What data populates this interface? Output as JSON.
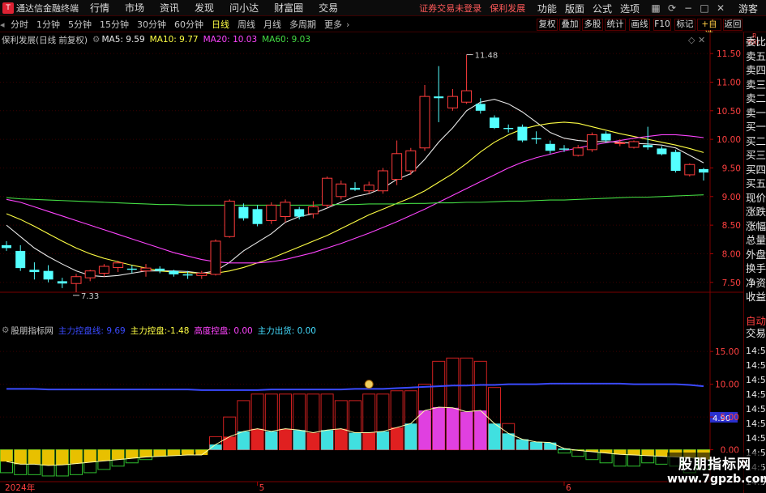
{
  "menubar": {
    "title": "通达信金融终端",
    "items": [
      "行情",
      "市场",
      "资讯",
      "发现",
      "问小达",
      "财富圈",
      "交易"
    ],
    "warnings": [
      "证券交易未登录",
      "保利发展"
    ],
    "right_items": [
      "功能",
      "版面",
      "公式",
      "选项"
    ],
    "guest": "游客"
  },
  "periodbar": {
    "periods": [
      "分时",
      "1分钟",
      "5分钟",
      "15分钟",
      "30分钟",
      "60分钟",
      "日线",
      "周线",
      "月线",
      "多周期",
      "更多"
    ],
    "active": "日线",
    "buttons": [
      "复权",
      "叠加",
      "多股",
      "统计",
      "画线",
      "F10",
      "标记",
      "+自选",
      "返回"
    ]
  },
  "price_panel": {
    "stock_label": "保利发展(日线 前复权)",
    "ma": [
      {
        "name": "MA5",
        "value": "9.59",
        "color": "#e8e8e8"
      },
      {
        "name": "MA10",
        "value": "9.77",
        "color": "#ffff44"
      },
      {
        "name": "MA20",
        "value": "10.03",
        "color": "#ff44ff"
      },
      {
        "name": "MA60",
        "value": "9.03",
        "color": "#44dd44"
      }
    ],
    "high_marker": "11.48",
    "low_marker": "7.33",
    "y_ticks": [
      "11.50",
      "11.00",
      "10.50",
      "10.00",
      "9.50",
      "9.00",
      "8.50",
      "8.00",
      "7.50"
    ]
  },
  "indicator_panel": {
    "label": "股朋指标网",
    "items": [
      {
        "name": "主力控盘线:",
        "value": "9.69",
        "color": "#3a4aff"
      },
      {
        "name": "主力控盘:",
        "value": "-1.48",
        "color": "#ffff44"
      },
      {
        "name": "高度控盘:",
        "value": "0.00",
        "color": "#ff44ff"
      },
      {
        "name": "主力出货:",
        "value": "0.00",
        "color": "#44ddff"
      }
    ],
    "y_ticks": [
      "15.00",
      "10.00",
      "5.00",
      "0.00"
    ],
    "current_tag": "4.90"
  },
  "right_panel": {
    "top_labels": [
      "R",
      "300"
    ],
    "labels": [
      "委比",
      "卖五",
      "卖四",
      "卖三",
      "卖二",
      "卖一",
      "买一",
      "买二",
      "买三",
      "买四",
      "买五",
      "现价",
      "涨跌",
      "涨幅",
      "总量",
      "外盘",
      "换手",
      "净资",
      "收益"
    ],
    "auto": "自动",
    "trade": "交易",
    "times": [
      "14:56",
      "14:56",
      "14:56",
      "14:56",
      "14:56",
      "14:56",
      "14:56",
      "14:56",
      "14:56",
      "14:56"
    ]
  },
  "x_axis": [
    "2024年",
    "5",
    "6"
  ],
  "watermark": {
    "line1": "股朋指标网",
    "line2": "www.7gpzb.com"
  },
  "chart_data": [
    {
      "type": "candlestick",
      "title": "保利发展(日线 前复权)",
      "ylim": [
        7.2,
        11.7
      ],
      "candles": [
        {
          "o": 8.15,
          "h": 8.22,
          "l": 8.05,
          "c": 8.1
        },
        {
          "o": 8.05,
          "h": 8.15,
          "l": 7.7,
          "c": 7.75
        },
        {
          "o": 7.72,
          "h": 7.85,
          "l": 7.55,
          "c": 7.68
        },
        {
          "o": 7.7,
          "h": 7.8,
          "l": 7.5,
          "c": 7.55
        },
        {
          "o": 7.52,
          "h": 7.58,
          "l": 7.4,
          "c": 7.48
        },
        {
          "o": 7.48,
          "h": 7.65,
          "l": 7.33,
          "c": 7.6
        },
        {
          "o": 7.58,
          "h": 7.72,
          "l": 7.52,
          "c": 7.7
        },
        {
          "o": 7.66,
          "h": 7.82,
          "l": 7.6,
          "c": 7.78
        },
        {
          "o": 7.76,
          "h": 7.88,
          "l": 7.68,
          "c": 7.84
        },
        {
          "o": 7.74,
          "h": 7.8,
          "l": 7.66,
          "c": 7.72
        },
        {
          "o": 7.7,
          "h": 7.82,
          "l": 7.6,
          "c": 7.75
        },
        {
          "o": 7.74,
          "h": 7.78,
          "l": 7.66,
          "c": 7.7
        },
        {
          "o": 7.7,
          "h": 7.72,
          "l": 7.6,
          "c": 7.64
        },
        {
          "o": 7.64,
          "h": 7.7,
          "l": 7.56,
          "c": 7.62
        },
        {
          "o": 7.62,
          "h": 7.7,
          "l": 7.56,
          "c": 7.66
        },
        {
          "o": 7.64,
          "h": 8.25,
          "l": 7.62,
          "c": 8.22
        },
        {
          "o": 8.3,
          "h": 8.95,
          "l": 8.28,
          "c": 8.92
        },
        {
          "o": 8.82,
          "h": 8.88,
          "l": 8.58,
          "c": 8.62
        },
        {
          "o": 8.78,
          "h": 8.85,
          "l": 8.48,
          "c": 8.52
        },
        {
          "o": 8.58,
          "h": 8.9,
          "l": 8.52,
          "c": 8.85
        },
        {
          "o": 8.65,
          "h": 8.95,
          "l": 8.55,
          "c": 8.9
        },
        {
          "o": 8.78,
          "h": 8.82,
          "l": 8.6,
          "c": 8.65
        },
        {
          "o": 8.7,
          "h": 8.92,
          "l": 8.62,
          "c": 8.82
        },
        {
          "o": 8.85,
          "h": 9.35,
          "l": 8.8,
          "c": 9.32
        },
        {
          "o": 9.0,
          "h": 9.28,
          "l": 8.95,
          "c": 9.22
        },
        {
          "o": 9.15,
          "h": 9.25,
          "l": 9.1,
          "c": 9.12
        },
        {
          "o": 9.1,
          "h": 9.26,
          "l": 9.05,
          "c": 9.2
        },
        {
          "o": 9.1,
          "h": 9.5,
          "l": 9.05,
          "c": 9.45
        },
        {
          "o": 9.3,
          "h": 9.98,
          "l": 9.2,
          "c": 9.75
        },
        {
          "o": 9.45,
          "h": 9.85,
          "l": 9.38,
          "c": 9.8
        },
        {
          "o": 9.85,
          "h": 10.95,
          "l": 9.8,
          "c": 10.75
        },
        {
          "o": 10.75,
          "h": 11.28,
          "l": 10.3,
          "c": 10.72
        },
        {
          "o": 10.55,
          "h": 10.88,
          "l": 10.5,
          "c": 10.75
        },
        {
          "o": 10.65,
          "h": 11.48,
          "l": 10.62,
          "c": 10.85
        },
        {
          "o": 10.62,
          "h": 10.72,
          "l": 10.45,
          "c": 10.5
        },
        {
          "o": 10.38,
          "h": 10.42,
          "l": 10.18,
          "c": 10.2
        },
        {
          "o": 10.2,
          "h": 10.26,
          "l": 10.12,
          "c": 10.18
        },
        {
          "o": 10.22,
          "h": 10.26,
          "l": 9.95,
          "c": 9.98
        },
        {
          "o": 10.02,
          "h": 10.14,
          "l": 9.92,
          "c": 10.0
        },
        {
          "o": 9.92,
          "h": 9.98,
          "l": 9.75,
          "c": 9.8
        },
        {
          "o": 9.84,
          "h": 9.9,
          "l": 9.78,
          "c": 9.82
        },
        {
          "o": 9.72,
          "h": 9.9,
          "l": 9.7,
          "c": 9.85
        },
        {
          "o": 9.82,
          "h": 10.12,
          "l": 9.78,
          "c": 10.08
        },
        {
          "o": 10.1,
          "h": 10.14,
          "l": 9.94,
          "c": 9.98
        },
        {
          "o": 9.94,
          "h": 10.0,
          "l": 9.88,
          "c": 9.94
        },
        {
          "o": 9.86,
          "h": 9.98,
          "l": 9.84,
          "c": 9.96
        },
        {
          "o": 9.9,
          "h": 10.22,
          "l": 9.82,
          "c": 9.86
        },
        {
          "o": 9.84,
          "h": 9.88,
          "l": 9.72,
          "c": 9.74
        },
        {
          "o": 9.78,
          "h": 9.82,
          "l": 9.42,
          "c": 9.45
        },
        {
          "o": 9.38,
          "h": 9.58,
          "l": 9.35,
          "c": 9.56
        },
        {
          "o": 9.48,
          "h": 9.5,
          "l": 9.28,
          "c": 9.42
        }
      ],
      "ma_series": [
        {
          "name": "MA5",
          "color": "#e8e8e8",
          "values": [
            8.5,
            8.3,
            8.1,
            7.95,
            7.82,
            7.7,
            7.62,
            7.6,
            7.62,
            7.66,
            7.7,
            7.7,
            7.7,
            7.69,
            7.66,
            7.7,
            7.85,
            8.05,
            8.2,
            8.35,
            8.55,
            8.65,
            8.7,
            8.8,
            8.9,
            9.0,
            9.05,
            9.15,
            9.3,
            9.4,
            9.65,
            9.95,
            10.2,
            10.5,
            10.65,
            10.7,
            10.62,
            10.48,
            10.3,
            10.12,
            10.02,
            9.98,
            9.96,
            9.96,
            9.95,
            9.93,
            9.92,
            9.9,
            9.85,
            9.72,
            9.59
          ]
        },
        {
          "name": "MA10",
          "color": "#ffff44",
          "values": [
            8.7,
            8.6,
            8.48,
            8.35,
            8.22,
            8.1,
            8.0,
            7.92,
            7.86,
            7.8,
            7.75,
            7.7,
            7.68,
            7.67,
            7.66,
            7.66,
            7.7,
            7.76,
            7.84,
            7.92,
            8.02,
            8.12,
            8.22,
            8.32,
            8.44,
            8.56,
            8.68,
            8.78,
            8.88,
            8.98,
            9.1,
            9.25,
            9.4,
            9.58,
            9.78,
            9.95,
            10.08,
            10.18,
            10.24,
            10.28,
            10.3,
            10.28,
            10.22,
            10.16,
            10.1,
            10.05,
            10.0,
            9.95,
            9.9,
            9.84,
            9.77
          ]
        },
        {
          "name": "MA20",
          "color": "#ff44ff",
          "values": [
            8.95,
            8.9,
            8.82,
            8.74,
            8.66,
            8.58,
            8.5,
            8.42,
            8.34,
            8.26,
            8.18,
            8.1,
            8.02,
            7.96,
            7.9,
            7.86,
            7.84,
            7.84,
            7.84,
            7.86,
            7.9,
            7.96,
            8.02,
            8.1,
            8.18,
            8.27,
            8.36,
            8.46,
            8.56,
            8.67,
            8.78,
            8.9,
            9.02,
            9.14,
            9.26,
            9.38,
            9.5,
            9.6,
            9.68,
            9.74,
            9.8,
            9.85,
            9.9,
            9.94,
            9.98,
            10.02,
            10.05,
            10.08,
            10.08,
            10.06,
            10.03
          ]
        },
        {
          "name": "MA60",
          "color": "#44dd44",
          "values": [
            8.98,
            8.96,
            8.95,
            8.94,
            8.93,
            8.92,
            8.91,
            8.9,
            8.89,
            8.88,
            8.87,
            8.86,
            8.86,
            8.85,
            8.85,
            8.85,
            8.85,
            8.85,
            8.85,
            8.85,
            8.85,
            8.85,
            8.85,
            8.86,
            8.86,
            8.86,
            8.87,
            8.87,
            8.87,
            8.88,
            8.88,
            8.89,
            8.89,
            8.9,
            8.9,
            8.91,
            8.92,
            8.92,
            8.93,
            8.94,
            8.94,
            8.95,
            8.96,
            8.97,
            8.98,
            8.99,
            8.99,
            9.0,
            9.01,
            9.02,
            9.03
          ]
        }
      ]
    },
    {
      "type": "bar",
      "title": "股朋指标网",
      "ylim": [
        -4.5,
        17
      ],
      "outline_values": [
        -3.5,
        -3.8,
        -3.8,
        -4.0,
        -4.0,
        -3.8,
        -3.5,
        -3.0,
        -2.5,
        -2.0,
        -1.5,
        -1.0,
        -0.8,
        -0.5,
        -0.3,
        2.0,
        5.0,
        7.5,
        8.5,
        8.5,
        8.5,
        8.5,
        8.5,
        8.5,
        7.5,
        7.5,
        8.5,
        8.5,
        9.0,
        9.0,
        10.0,
        13.5,
        14.0,
        14.0,
        13.5,
        9.5,
        4.0,
        1.5,
        1.0,
        0.8,
        -0.5,
        -1.0,
        -1.5,
        -2.0,
        -2.5,
        -2.5,
        -2.0,
        -2.2,
        -2.5,
        -3.5,
        -3.0
      ],
      "filled_values": [
        -1.8,
        -2.2,
        -2.2,
        -2.4,
        -2.3,
        -2.1,
        -1.9,
        -1.7,
        -1.5,
        -1.3,
        -1.1,
        -1.0,
        -0.9,
        -0.8,
        -0.8,
        0.8,
        2.0,
        2.8,
        3.2,
        2.8,
        3.2,
        3.0,
        2.6,
        3.0,
        3.2,
        2.6,
        2.6,
        2.8,
        3.4,
        4.0,
        6.0,
        6.5,
        6.4,
        5.8,
        6.0,
        4.0,
        2.5,
        1.6,
        1.2,
        1.1,
        0.2,
        -0.1,
        -0.3,
        -0.5,
        -0.7,
        -0.8,
        -0.9,
        -1.0,
        -1.1,
        -1.2,
        -1.48
      ],
      "series": [
        {
          "name": "主力控盘线",
          "values": [
            9.3,
            9.3,
            9.3,
            9.2,
            9.2,
            9.2,
            9.2,
            9.2,
            9.2,
            9.2,
            9.2,
            9.2,
            9.2,
            9.2,
            9.1,
            9.1,
            9.1,
            9.1,
            9.1,
            9.2,
            9.2,
            9.2,
            9.2,
            9.2,
            9.2,
            9.3,
            9.3,
            9.3,
            9.4,
            9.5,
            9.6,
            9.7,
            9.8,
            9.8,
            9.9,
            9.9,
            10.0,
            10.0,
            10.0,
            10.1,
            10.1,
            10.1,
            10.1,
            10.1,
            10.1,
            10.0,
            10.0,
            10.0,
            10.0,
            9.9,
            9.69
          ]
        }
      ]
    }
  ]
}
